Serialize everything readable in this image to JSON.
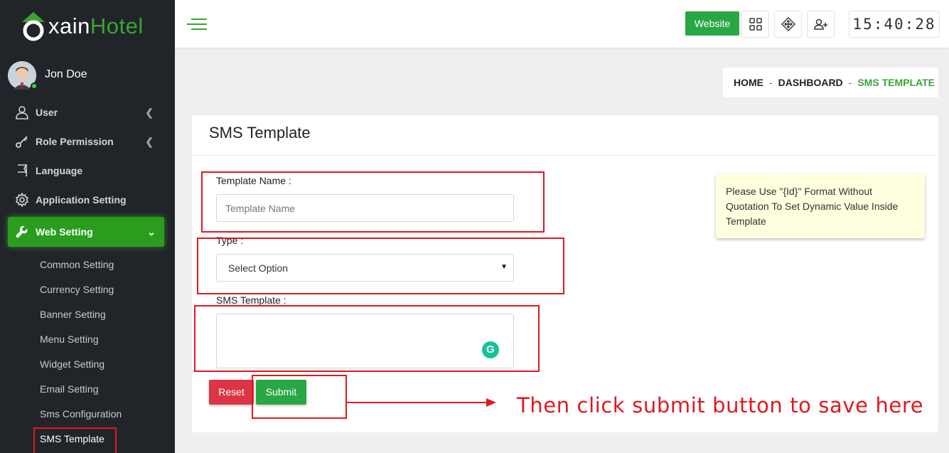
{
  "app": {
    "logo_prefix": "xain",
    "logo_highlight": "Hotel"
  },
  "user": {
    "name": "Jon Doe"
  },
  "sidebar": {
    "items": [
      {
        "label": "User",
        "icon": "user-icon"
      },
      {
        "label": "Role Permission",
        "icon": "key-icon"
      },
      {
        "label": "Language",
        "icon": "flag-icon"
      },
      {
        "label": "Application Setting",
        "icon": "gear-icon"
      },
      {
        "label": "Web Setting",
        "icon": "wrench-icon"
      }
    ],
    "subitems": [
      "Common Setting",
      "Currency Setting",
      "Banner Setting",
      "Menu Setting",
      "Widget Setting",
      "Email Setting",
      "Sms Configuration",
      "SMS Template"
    ]
  },
  "topbar": {
    "website_label": "Website",
    "clock": "15:40:28"
  },
  "breadcrumb": {
    "home": "HOME",
    "dashboard": "DASHBOARD",
    "current": "SMS TEMPLATE"
  },
  "form": {
    "title": "SMS Template",
    "template_name_label": "Template Name :",
    "template_name_placeholder": "Template Name",
    "type_label": "Type :",
    "type_selected": "Select Option",
    "sms_template_label": "SMS Template :",
    "note": "Please Use \"{Id}\" Format Without Quotation To Set Dynamic Value Inside Template",
    "reset_label": "Reset",
    "submit_label": "Submit"
  },
  "annotation": {
    "text": "Then click submit button to save here"
  },
  "colors": {
    "accent": "#28a745",
    "brand_green": "#3aa531",
    "sidebar_bg": "#212529",
    "annotation_red": "#e0191f",
    "reset_red": "#dc3545"
  }
}
